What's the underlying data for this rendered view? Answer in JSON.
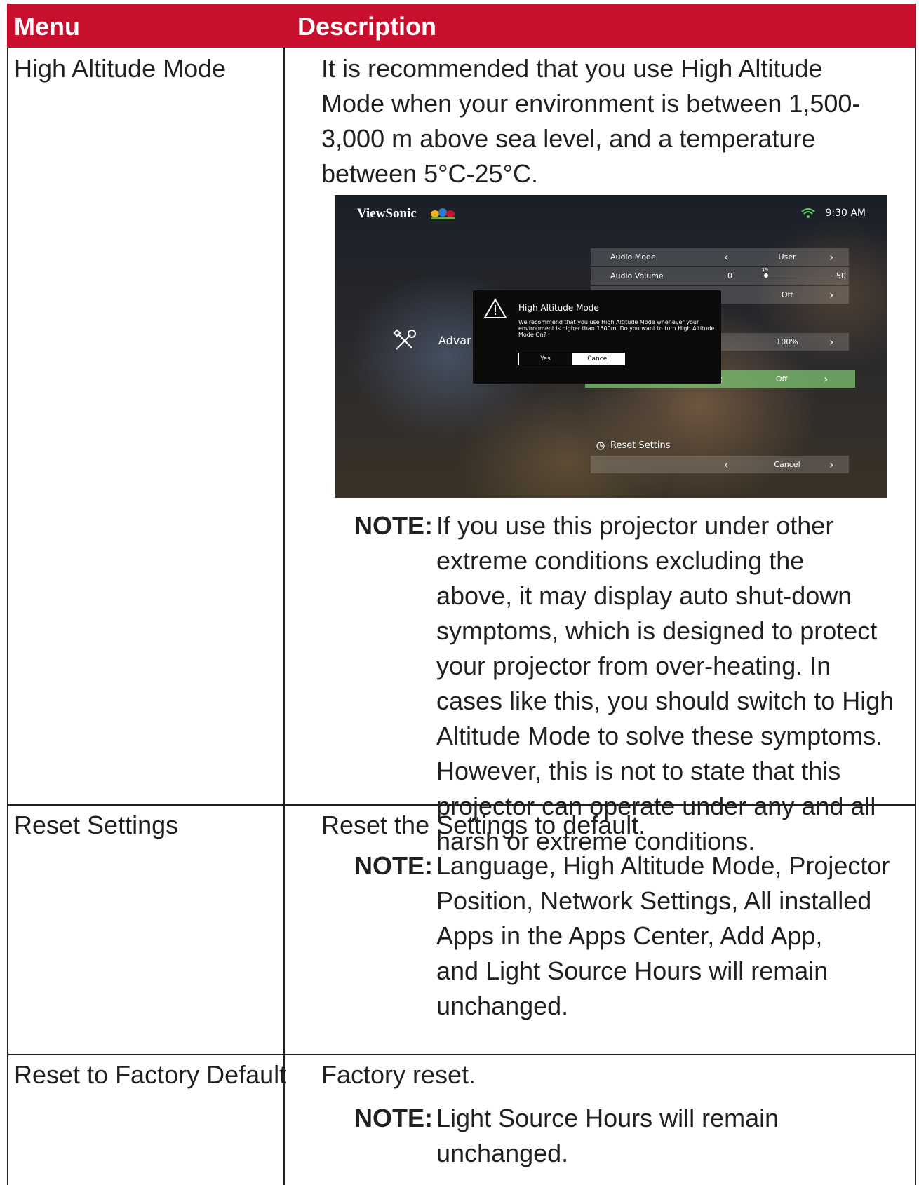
{
  "header": {
    "menu": "Menu",
    "description": "Description"
  },
  "colors": {
    "header_bg": "#c8102e",
    "header_text": "#ffffff",
    "grid": "#231f20"
  },
  "rows": [
    {
      "menu": "High Altitude Mode",
      "desc_lines": [
        "It is recommended that you use High Altitude",
        "Mode when your environment is between 1,500-",
        "3,000 m above sea level, and a temperature",
        "between 5°C-25°C."
      ],
      "note_label": "NOTE:",
      "note_lines": [
        "If you use this projector under other",
        "extreme conditions excluding the",
        "above, it may display auto shut-down",
        "symptoms, which is designed to protect",
        "your projector from over-heating. In",
        "cases like this, you should switch to High",
        "Altitude Mode to solve these symptoms.",
        "However, this is not to state that this",
        "projector can operate under any and all",
        "harsh or extreme conditions."
      ]
    },
    {
      "menu": "Reset Settings",
      "desc_lines": [
        "Reset the Settings to default."
      ],
      "note_label": "NOTE:",
      "note_lines": [
        "Language, High Altitude Mode, Projector",
        "Position, Network Settings, All installed",
        "Apps in the Apps Center, Add App,",
        "and Light Source Hours will remain",
        "unchanged."
      ]
    },
    {
      "menu": "Reset to Factory Default",
      "desc_lines": [
        "Factory reset."
      ],
      "note_label": "NOTE:",
      "note_lines": [
        "Light Source Hours will remain",
        "unchanged."
      ]
    }
  ],
  "screenshot": {
    "brand": "ViewSonic",
    "time": "9:30 AM",
    "side_label": "Advar",
    "audio_mode": {
      "label": "Audio Mode",
      "value": "User"
    },
    "audio_volume": {
      "label": "Audio Volume",
      "min": "0",
      "max": "50",
      "current": "19"
    },
    "row3_value": "Off",
    "row4_value": "100%",
    "high_altitude_value": "Off",
    "reset_settings_label": "Reset Settins",
    "reset_value": "Cancel",
    "dialog": {
      "title": "High Altitude Mode",
      "text": "We recommend that you use High Altitude Mode whenever your environment is higher than 1500m. Do you want to turn High Altitude Mode On?",
      "yes": "Yes",
      "cancel": "Cancel"
    }
  }
}
